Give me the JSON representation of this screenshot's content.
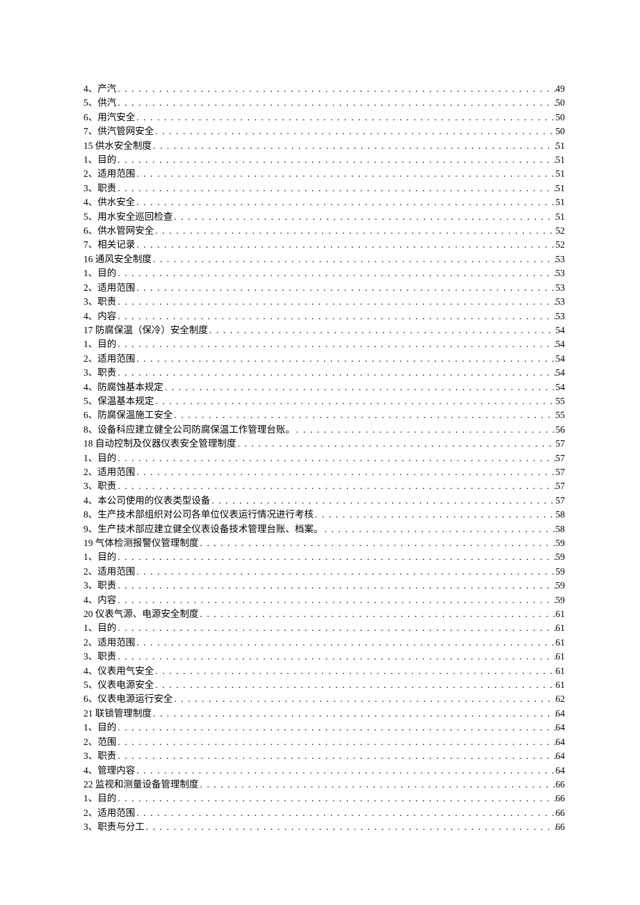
{
  "toc": [
    {
      "label": "4、产汽",
      "page": "49"
    },
    {
      "label": "5、供汽",
      "page": "50"
    },
    {
      "label": "6、用汽安全",
      "page": "50"
    },
    {
      "label": "7、供汽管网安全",
      "page": "50"
    },
    {
      "label": "15 供水安全制度",
      "page": "51"
    },
    {
      "label": "1、目的",
      "page": "51"
    },
    {
      "label": "2、适用范围",
      "page": "51"
    },
    {
      "label": "3、职责",
      "page": "51"
    },
    {
      "label": "4、供水安全",
      "page": "51"
    },
    {
      "label": "5、用水安全巡回检查",
      "page": "51"
    },
    {
      "label": "6、供水管网安全",
      "page": "52"
    },
    {
      "label": "7、相关记录",
      "page": "52"
    },
    {
      "label": "16 通风安全制度",
      "page": "53"
    },
    {
      "label": "1、目的",
      "page": "53"
    },
    {
      "label": "2、适用范围",
      "page": "53"
    },
    {
      "label": "3、职责",
      "page": "53"
    },
    {
      "label": "4、内容",
      "page": "53"
    },
    {
      "label": "17 防腐保温（保冷）安全制度",
      "page": "54"
    },
    {
      "label": "1、目的",
      "page": "54"
    },
    {
      "label": "2、适用范围",
      "page": "54"
    },
    {
      "label": "3、职责",
      "page": "54"
    },
    {
      "label": "4、防腐蚀基本规定",
      "page": "54"
    },
    {
      "label": "5、保温基本规定",
      "page": "55"
    },
    {
      "label": "6、防腐保温施工安全",
      "page": "55"
    },
    {
      "label": "8、设备科应建立健全公司防腐保温工作管理台账。",
      "page": "56"
    },
    {
      "label": "18 自动控制及仪器仪表安全管理制度",
      "page": "57"
    },
    {
      "label": "1、目的",
      "page": "57"
    },
    {
      "label": "2、适用范围",
      "page": "57"
    },
    {
      "label": "3、职责",
      "page": "57"
    },
    {
      "label": "4、本公司使用的仪表类型设备",
      "page": "57"
    },
    {
      "label": "8、生产技术部组织对公司各单位仪表运行情况进行考核",
      "page": "58"
    },
    {
      "label": "9、生产技术部应建立健全仪表设备技术管理台账、档案。",
      "page": "58"
    },
    {
      "label": "19 气体检测报警仪管理制度",
      "page": "59"
    },
    {
      "label": "1、目的",
      "page": "59"
    },
    {
      "label": "2、适用范围",
      "page": "59"
    },
    {
      "label": "3、职责",
      "page": "59"
    },
    {
      "label": "4、内容",
      "page": "59"
    },
    {
      "label": "20 仪表气源、电源安全制度",
      "page": "61"
    },
    {
      "label": "1、目的",
      "page": "61"
    },
    {
      "label": "2、适用范围",
      "page": "61"
    },
    {
      "label": "3、职责",
      "page": "61"
    },
    {
      "label": "4、仪表用气安全",
      "page": "61"
    },
    {
      "label": "5、仪表电源安全",
      "page": "61"
    },
    {
      "label": "6、仪表电源运行安全",
      "page": "62"
    },
    {
      "label": "21 联锁管理制度",
      "page": "64"
    },
    {
      "label": "1、目的",
      "page": "64"
    },
    {
      "label": "2、范围",
      "page": "64"
    },
    {
      "label": "3、职责",
      "page": "64"
    },
    {
      "label": "4、管理内容",
      "page": "64"
    },
    {
      "label": "22 监视和测量设备管理制度",
      "page": "66"
    },
    {
      "label": "1、目的",
      "page": "66"
    },
    {
      "label": "2、适用范围",
      "page": "66"
    },
    {
      "label": "3、职责与分工",
      "page": "66"
    }
  ]
}
